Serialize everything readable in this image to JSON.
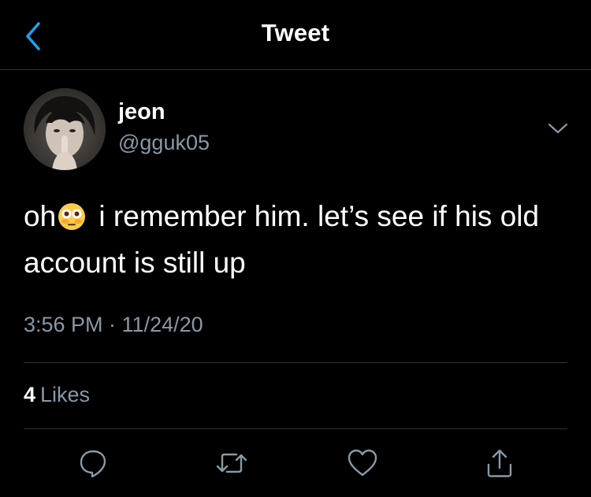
{
  "header": {
    "title": "Tweet",
    "back_icon": "chevron-left-icon"
  },
  "tweet": {
    "author": {
      "display_name": "jeon",
      "handle": "@gguk05",
      "avatar": "avatar-photo"
    },
    "text": {
      "before_emoji": "oh",
      "emoji": "flushed-face-emoji",
      "after_emoji": " i remember him. let’s see if his old account is still up"
    },
    "timestamp": "3:56 PM · 11/24/20",
    "likes": {
      "count": "4",
      "label": "Likes"
    },
    "actions": [
      "reply-icon",
      "retweet-icon",
      "like-icon",
      "share-icon"
    ]
  },
  "colors": {
    "background": "#000000",
    "text_primary": "#ffffff",
    "text_secondary": "#8899a6",
    "accent": "#1da1f2",
    "divider": "#2f3336"
  }
}
